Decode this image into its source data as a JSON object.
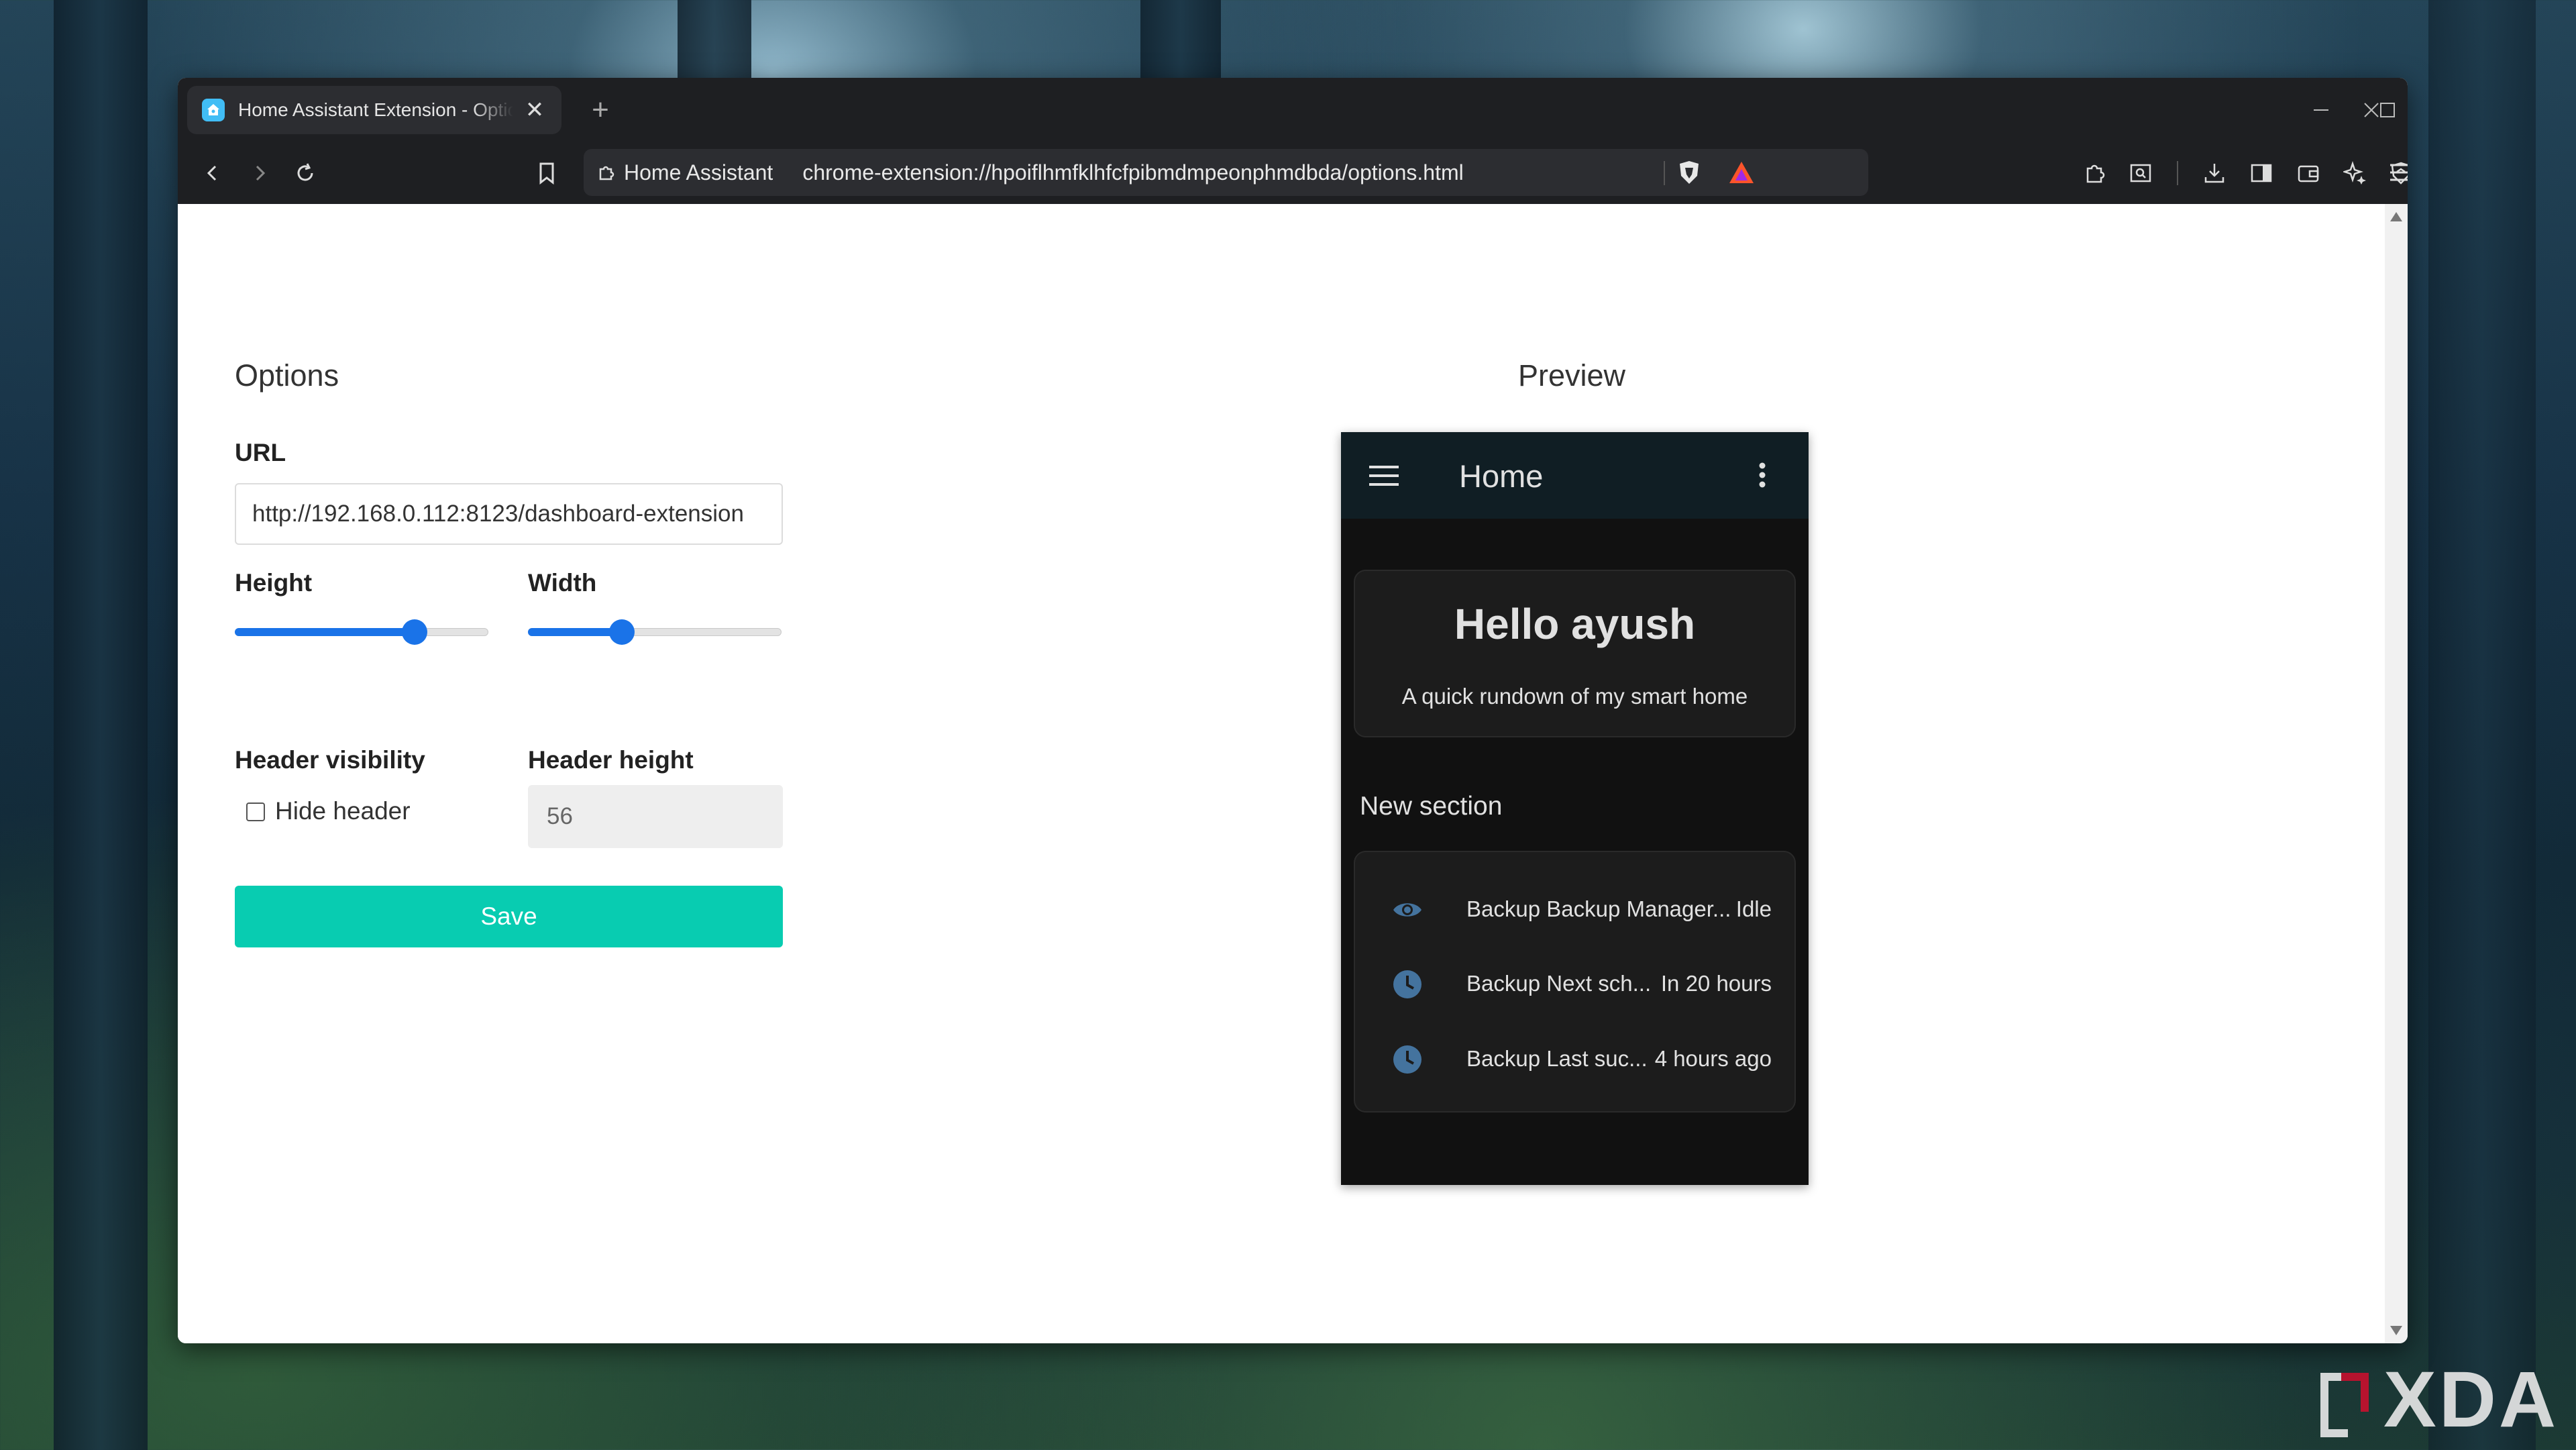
{
  "browser": {
    "tab_title": "Home Assistant Extension - Options",
    "new_tab_symbol": "+",
    "site_chip_label": "Home Assistant",
    "url": "chrome-extension://hpoiflhmfklhfcfpibmdmpeonphmdbda/options.html"
  },
  "options": {
    "heading": "Options",
    "url_label": "URL",
    "url_value": "http://192.168.0.112:8123/dashboard-extension",
    "height_label": "Height",
    "height_level": 0.71,
    "width_label": "Width",
    "width_level": 0.37,
    "header_visibility_label": "Header visibility",
    "hide_header_label": "Hide header",
    "hide_header_checked": false,
    "header_height_label": "Header height",
    "header_height_value": "56",
    "save_label": "Save"
  },
  "preview": {
    "heading": "Preview",
    "app_title": "Home",
    "greeting": "Hello ayush",
    "greeting_sub": "A quick rundown of my smart home",
    "section_title": "New section",
    "entities": [
      {
        "icon": "eye-icon",
        "name": "Backup Backup Manager...",
        "state": "Idle"
      },
      {
        "icon": "clock-icon",
        "name": "Backup Next sch...",
        "state": "In 20 hours"
      },
      {
        "icon": "clock-icon",
        "name": "Backup Last suc...",
        "state": "4 hours ago"
      }
    ]
  },
  "watermark": "XDA",
  "colors": {
    "accent_blue": "#1a73e8",
    "save_teal": "#08ccb1",
    "ha_blue": "#41bdf5",
    "preview_bg": "#111111"
  }
}
